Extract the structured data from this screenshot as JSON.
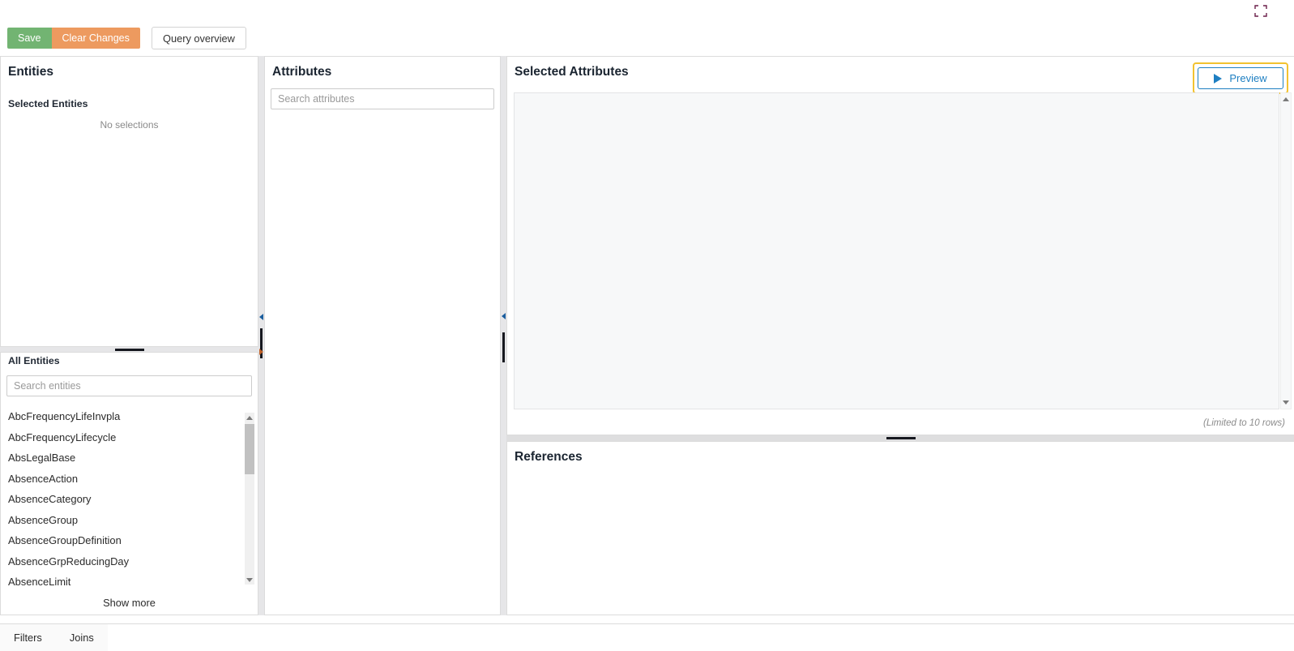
{
  "topbar": {
    "expand_icon": "expand-fullscreen-icon"
  },
  "toolbar": {
    "save_label": "Save",
    "clear_changes_label": "Clear Changes",
    "query_overview_label": "Query overview",
    "save_color": "#72b472",
    "clear_color": "#ed9a5f"
  },
  "entities": {
    "title": "Entities",
    "selected_section_title": "Selected Entities",
    "no_selections_text": "No selections",
    "all_section_title": "All Entities",
    "search_placeholder": "Search entities",
    "search_value": "",
    "items": [
      "AbcFrequencyLifeInvpla",
      "AbcFrequencyLifecycle",
      "AbsLegalBase",
      "AbsenceAction",
      "AbsenceCategory",
      "AbsenceGroup",
      "AbsenceGroupDefinition",
      "AbsenceGrpReducingDay",
      "AbsenceLimit"
    ],
    "show_more_label": "Show more"
  },
  "attributes": {
    "title": "Attributes",
    "search_placeholder": "Search attributes",
    "search_value": ""
  },
  "selected_attributes": {
    "title": "Selected Attributes",
    "preview_label": "Preview",
    "preview_icon": "play-triangle-icon",
    "preview_focus_color": "#f2c230",
    "preview_accent_color": "#1e7fc2",
    "limited_rows_note": "(Limited to 10 rows)"
  },
  "references": {
    "title": "References"
  },
  "bottom_tabs": {
    "filters_label": "Filters",
    "joins_label": "Joins"
  }
}
